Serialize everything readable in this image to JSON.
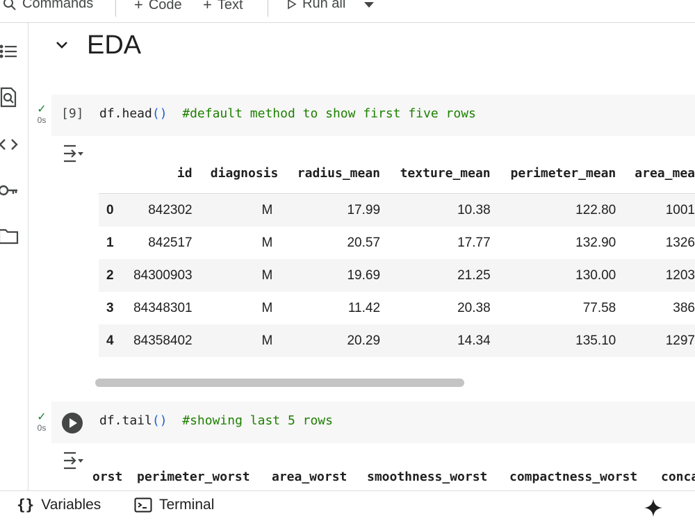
{
  "toolbar": {
    "commands_label": "Commands",
    "code_label": "Code",
    "text_label": "Text",
    "run_all_label": "Run all"
  },
  "rail": {
    "icons": [
      "table-of-contents-icon",
      "find-icon",
      "code-snippets-icon",
      "secrets-key-icon",
      "files-folder-icon"
    ]
  },
  "section": {
    "title": "EDA"
  },
  "cell1": {
    "exec_count": "[9]",
    "status_time": "0s",
    "code_fn": "df.head",
    "code_parens": "()",
    "code_comment": "#default method to show first five rows"
  },
  "head_table": {
    "columns": [
      "id",
      "diagnosis",
      "radius_mean",
      "texture_mean",
      "perimeter_mean",
      "area_mea"
    ],
    "rows": [
      {
        "index": "0",
        "id": "842302",
        "diagnosis": "M",
        "radius_mean": "17.99",
        "texture_mean": "10.38",
        "perimeter_mean": "122.80",
        "area_mean": "1001"
      },
      {
        "index": "1",
        "id": "842517",
        "diagnosis": "M",
        "radius_mean": "20.57",
        "texture_mean": "17.77",
        "perimeter_mean": "132.90",
        "area_mean": "1326"
      },
      {
        "index": "2",
        "id": "84300903",
        "diagnosis": "M",
        "radius_mean": "19.69",
        "texture_mean": "21.25",
        "perimeter_mean": "130.00",
        "area_mean": "1203"
      },
      {
        "index": "3",
        "id": "84348301",
        "diagnosis": "M",
        "radius_mean": "11.42",
        "texture_mean": "20.38",
        "perimeter_mean": "77.58",
        "area_mean": "386"
      },
      {
        "index": "4",
        "id": "84358402",
        "diagnosis": "M",
        "radius_mean": "20.29",
        "texture_mean": "14.34",
        "perimeter_mean": "135.10",
        "area_mean": "1297"
      }
    ]
  },
  "cell2": {
    "status_time": "0s",
    "code_fn": "df.tail",
    "code_parens": "()",
    "code_comment": "#showing last 5 rows"
  },
  "tail_table": {
    "columns": [
      "orst",
      "perimeter_worst",
      "area_worst",
      "smoothness_worst",
      "compactness_worst",
      "conca"
    ]
  },
  "bottombar": {
    "variables_label": "Variables",
    "terminal_label": "Terminal"
  },
  "colors": {
    "comment_green": "#1e8000",
    "paren_blue": "#1a5fd0",
    "check_green": "#188038",
    "cell_bg": "#f7f7f7"
  }
}
